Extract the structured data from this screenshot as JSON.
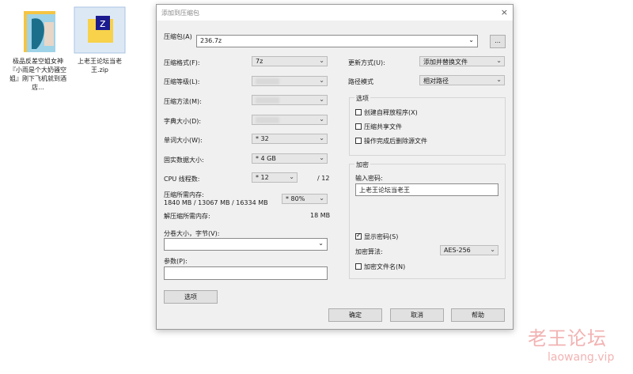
{
  "desktop": {
    "icons": [
      {
        "label": "极品反差空姐女神『小雨是个大奶骚空姐』刚下飞机就到酒店...",
        "icon": "folder-icon"
      },
      {
        "label": "上老王论坛当老王.zip",
        "icon": "zip-archive-icon"
      }
    ]
  },
  "dialog": {
    "title": "添加到压缩包",
    "close_label": "×",
    "archive_label": "压缩包(A)",
    "archive_value": "236.7z",
    "browse_label": "...",
    "format_label": "压缩格式(F):",
    "format_value": "7z",
    "level_label": "压缩等级(L):",
    "method_label": "压缩方法(M):",
    "dict_label": "字典大小(D):",
    "word_label": "单词大小(W):",
    "word_value": "* 32",
    "solid_label": "固实数据大小:",
    "solid_value": "* 4 GB",
    "cpu_label": "CPU 线程数:",
    "cpu_value": "* 12",
    "cpu_total": "/ 12",
    "mem_comp_label": "压缩所需内存:",
    "mem_comp_detail": "1840 MB / 13067 MB / 16334 MB",
    "mem_comp_pct": "* 80%",
    "mem_decomp_label": "解压缩所需内存:",
    "mem_decomp_value": "18 MB",
    "split_label": "分卷大小，字节(V):",
    "split_value": "",
    "params_label": "参数(P):",
    "params_value": "",
    "options_button": "选项",
    "update_label": "更新方式(U):",
    "update_value": "添加并替换文件",
    "path_label": "路径模式",
    "path_value": "相对路径",
    "options_group": "选项",
    "opt_sfx": "创建自释放程序(X)",
    "opt_shared": "压缩共享文件",
    "opt_delete": "操作完成后删除源文件",
    "encrypt_group": "加密",
    "password_label": "输入密码:",
    "password_value": "上老王论坛当老王",
    "show_password": "显示密码(S)",
    "enc_method_label": "加密算法:",
    "enc_method_value": "AES-256",
    "encrypt_names": "加密文件名(N)",
    "ok": "确定",
    "cancel": "取消",
    "help": "帮助"
  },
  "watermark": {
    "cn": "老王论坛",
    "en": "laowang.vip"
  }
}
